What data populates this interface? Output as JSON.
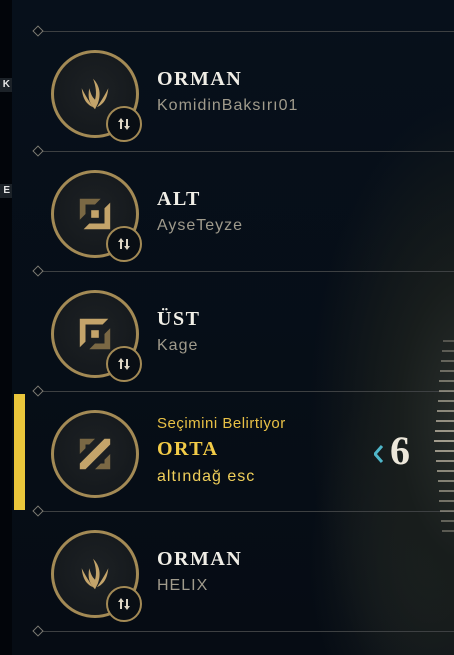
{
  "edge_tabs": [
    "K",
    "E"
  ],
  "slots": [
    {
      "role": "ORMAN",
      "summoner": "KomidinBaksırı01",
      "icon": "jungle-icon",
      "status": "",
      "active": false
    },
    {
      "role": "ALT",
      "summoner": "AyseTeyze",
      "icon": "bottom-lane-icon",
      "status": "",
      "active": false
    },
    {
      "role": "ÜST",
      "summoner": "Kage",
      "icon": "top-lane-icon",
      "status": "",
      "active": false
    },
    {
      "role": "ORTA",
      "summoner": "altındağ esc",
      "icon": "middle-lane-icon",
      "status": "Seçimini Belirtiyor",
      "active": true
    },
    {
      "role": "ORMAN",
      "summoner": "HELIX",
      "icon": "jungle-icon",
      "status": "",
      "active": false
    }
  ],
  "timer": {
    "value": "6",
    "icon": "chevron-left-icon"
  },
  "colors": {
    "accent": "#eac63b",
    "gold": "#a38a55",
    "text": "#f0eee6",
    "muted": "#a09b8c",
    "background": "#060c14"
  }
}
